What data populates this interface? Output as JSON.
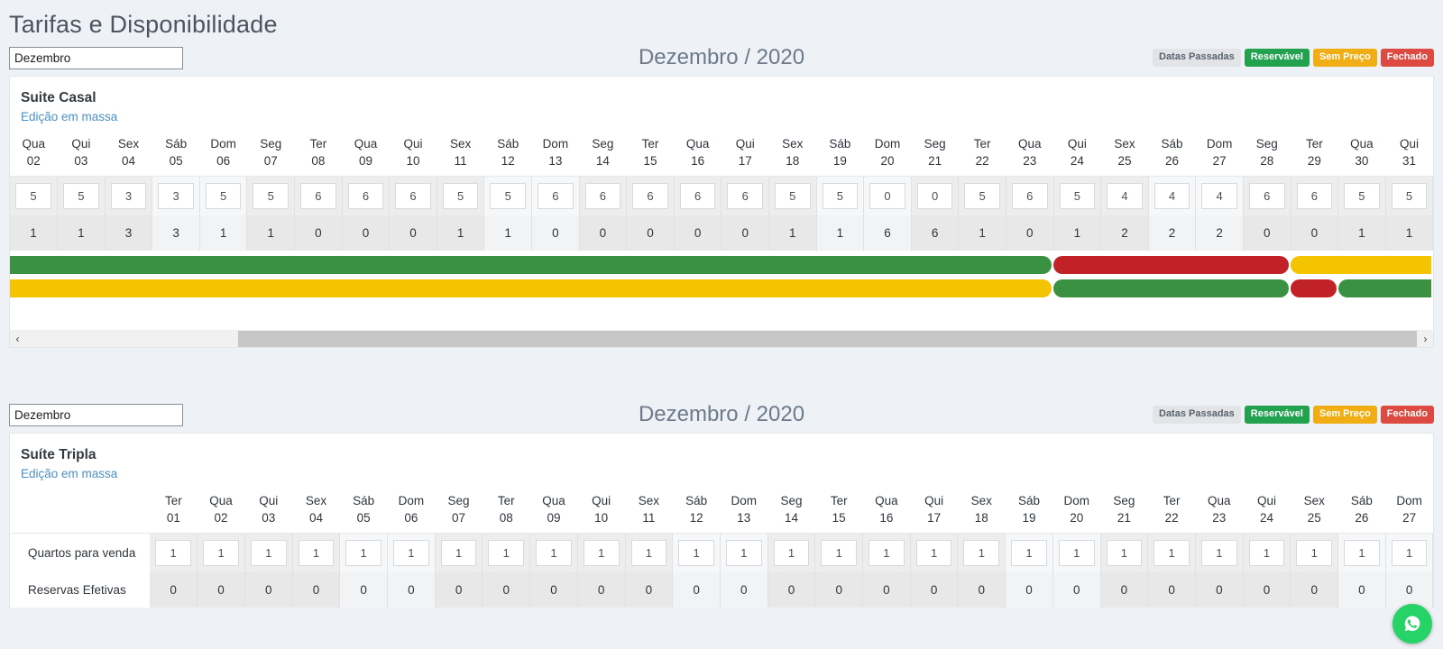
{
  "page": {
    "title": "Tarifas e Disponibilidade"
  },
  "legend": {
    "past": "Datas Passadas",
    "bookable": "Reservável",
    "noprice": "Sem Preço",
    "closed": "Fechado",
    "colors": {
      "past_bg": "#e2e4e8",
      "past_fg": "#5a636d",
      "bookable": "#22a14f",
      "noprice": "#f0ad14",
      "closed": "#dd4a41"
    }
  },
  "sections": [
    {
      "month_value": "Dezembro",
      "month_placeholder": "Dezembro",
      "month_title": "Dezembro / 2020",
      "room_name": "Suite Casal",
      "bulk_edit": "Edição em massa",
      "row1_label": "",
      "row2_label": "",
      "days": [
        {
          "dow": "Qua",
          "num": "02",
          "weekend": false,
          "rate": "5",
          "avail": "1"
        },
        {
          "dow": "Qui",
          "num": "03",
          "weekend": false,
          "rate": "5",
          "avail": "1"
        },
        {
          "dow": "Sex",
          "num": "04",
          "weekend": false,
          "rate": "3",
          "avail": "3"
        },
        {
          "dow": "Sáb",
          "num": "05",
          "weekend": true,
          "rate": "3",
          "avail": "3"
        },
        {
          "dow": "Dom",
          "num": "06",
          "weekend": true,
          "rate": "5",
          "avail": "1"
        },
        {
          "dow": "Seg",
          "num": "07",
          "weekend": false,
          "rate": "5",
          "avail": "1"
        },
        {
          "dow": "Ter",
          "num": "08",
          "weekend": false,
          "rate": "6",
          "avail": "0"
        },
        {
          "dow": "Qua",
          "num": "09",
          "weekend": false,
          "rate": "6",
          "avail": "0"
        },
        {
          "dow": "Qui",
          "num": "10",
          "weekend": false,
          "rate": "6",
          "avail": "0"
        },
        {
          "dow": "Sex",
          "num": "11",
          "weekend": false,
          "rate": "5",
          "avail": "1"
        },
        {
          "dow": "Sáb",
          "num": "12",
          "weekend": true,
          "rate": "5",
          "avail": "1"
        },
        {
          "dow": "Dom",
          "num": "13",
          "weekend": true,
          "rate": "6",
          "avail": "0"
        },
        {
          "dow": "Seg",
          "num": "14",
          "weekend": false,
          "rate": "6",
          "avail": "0"
        },
        {
          "dow": "Ter",
          "num": "15",
          "weekend": false,
          "rate": "6",
          "avail": "0"
        },
        {
          "dow": "Qua",
          "num": "16",
          "weekend": false,
          "rate": "6",
          "avail": "0"
        },
        {
          "dow": "Qui",
          "num": "17",
          "weekend": false,
          "rate": "6",
          "avail": "0"
        },
        {
          "dow": "Sex",
          "num": "18",
          "weekend": false,
          "rate": "5",
          "avail": "1"
        },
        {
          "dow": "Sáb",
          "num": "19",
          "weekend": true,
          "rate": "5",
          "avail": "1"
        },
        {
          "dow": "Dom",
          "num": "20",
          "weekend": true,
          "rate": "0",
          "avail": "6"
        },
        {
          "dow": "Seg",
          "num": "21",
          "weekend": false,
          "rate": "0",
          "avail": "6"
        },
        {
          "dow": "Ter",
          "num": "22",
          "weekend": false,
          "rate": "5",
          "avail": "1"
        },
        {
          "dow": "Qua",
          "num": "23",
          "weekend": false,
          "rate": "6",
          "avail": "0"
        },
        {
          "dow": "Qui",
          "num": "24",
          "weekend": false,
          "rate": "5",
          "avail": "1"
        },
        {
          "dow": "Sex",
          "num": "25",
          "weekend": false,
          "rate": "4",
          "avail": "2"
        },
        {
          "dow": "Sáb",
          "num": "26",
          "weekend": true,
          "rate": "4",
          "avail": "2"
        },
        {
          "dow": "Dom",
          "num": "27",
          "weekend": true,
          "rate": "4",
          "avail": "2"
        },
        {
          "dow": "Seg",
          "num": "28",
          "weekend": false,
          "rate": "6",
          "avail": "0"
        },
        {
          "dow": "Ter",
          "num": "29",
          "weekend": false,
          "rate": "6",
          "avail": "0"
        },
        {
          "dow": "Qua",
          "num": "30",
          "weekend": false,
          "rate": "5",
          "avail": "1"
        },
        {
          "dow": "Qui",
          "num": "31",
          "weekend": false,
          "rate": "5",
          "avail": "1"
        }
      ],
      "status_bars": [
        {
          "name": "bar-row-1",
          "segments": [
            {
              "status": "bookable",
              "color": "#3a9142",
              "start_day": "02",
              "end_day": "23"
            },
            {
              "status": "closed",
              "color": "#c12228",
              "start_day": "24",
              "end_day": "28"
            },
            {
              "status": "noprice",
              "color": "#f5c400",
              "start_day": "29",
              "end_day": "31"
            }
          ]
        },
        {
          "name": "bar-row-2",
          "segments": [
            {
              "status": "noprice",
              "color": "#f5c400",
              "start_day": "02",
              "end_day": "23"
            },
            {
              "status": "bookable",
              "color": "#3a9142",
              "start_day": "24",
              "end_day": "28"
            },
            {
              "status": "closed",
              "color": "#c12228",
              "start_day": "29",
              "end_day": "29"
            },
            {
              "status": "bookable",
              "color": "#3a9142",
              "start_day": "30",
              "end_day": "31"
            }
          ]
        }
      ],
      "scrollbar": {
        "left_arrow": "‹",
        "right_arrow": "›"
      }
    },
    {
      "month_value": "Dezembro",
      "month_placeholder": "Dezembro",
      "month_title": "Dezembro / 2020",
      "room_name": "Suíte Tripla",
      "bulk_edit": "Edição em massa",
      "row1_label": "Quartos para venda",
      "row2_label": "Reservas Efetivas",
      "days": [
        {
          "dow": "Ter",
          "num": "01",
          "weekend": false,
          "rate": "1",
          "avail": "0"
        },
        {
          "dow": "Qua",
          "num": "02",
          "weekend": false,
          "rate": "1",
          "avail": "0"
        },
        {
          "dow": "Qui",
          "num": "03",
          "weekend": false,
          "rate": "1",
          "avail": "0"
        },
        {
          "dow": "Sex",
          "num": "04",
          "weekend": false,
          "rate": "1",
          "avail": "0"
        },
        {
          "dow": "Sáb",
          "num": "05",
          "weekend": true,
          "rate": "1",
          "avail": "0"
        },
        {
          "dow": "Dom",
          "num": "06",
          "weekend": true,
          "rate": "1",
          "avail": "0"
        },
        {
          "dow": "Seg",
          "num": "07",
          "weekend": false,
          "rate": "1",
          "avail": "0"
        },
        {
          "dow": "Ter",
          "num": "08",
          "weekend": false,
          "rate": "1",
          "avail": "0"
        },
        {
          "dow": "Qua",
          "num": "09",
          "weekend": false,
          "rate": "1",
          "avail": "0"
        },
        {
          "dow": "Qui",
          "num": "10",
          "weekend": false,
          "rate": "1",
          "avail": "0"
        },
        {
          "dow": "Sex",
          "num": "11",
          "weekend": false,
          "rate": "1",
          "avail": "0"
        },
        {
          "dow": "Sáb",
          "num": "12",
          "weekend": true,
          "rate": "1",
          "avail": "0"
        },
        {
          "dow": "Dom",
          "num": "13",
          "weekend": true,
          "rate": "1",
          "avail": "0"
        },
        {
          "dow": "Seg",
          "num": "14",
          "weekend": false,
          "rate": "1",
          "avail": "0"
        },
        {
          "dow": "Ter",
          "num": "15",
          "weekend": false,
          "rate": "1",
          "avail": "0"
        },
        {
          "dow": "Qua",
          "num": "16",
          "weekend": false,
          "rate": "1",
          "avail": "0"
        },
        {
          "dow": "Qui",
          "num": "17",
          "weekend": false,
          "rate": "1",
          "avail": "0"
        },
        {
          "dow": "Sex",
          "num": "18",
          "weekend": false,
          "rate": "1",
          "avail": "0"
        },
        {
          "dow": "Sáb",
          "num": "19",
          "weekend": true,
          "rate": "1",
          "avail": "0"
        },
        {
          "dow": "Dom",
          "num": "20",
          "weekend": true,
          "rate": "1",
          "avail": "0"
        },
        {
          "dow": "Seg",
          "num": "21",
          "weekend": false,
          "rate": "1",
          "avail": "0"
        },
        {
          "dow": "Ter",
          "num": "22",
          "weekend": false,
          "rate": "1",
          "avail": "0"
        },
        {
          "dow": "Qua",
          "num": "23",
          "weekend": false,
          "rate": "1",
          "avail": "0"
        },
        {
          "dow": "Qui",
          "num": "24",
          "weekend": false,
          "rate": "1",
          "avail": "0"
        },
        {
          "dow": "Sex",
          "num": "25",
          "weekend": false,
          "rate": "1",
          "avail": "0"
        },
        {
          "dow": "Sáb",
          "num": "26",
          "weekend": true,
          "rate": "1",
          "avail": "0"
        },
        {
          "dow": "Dom",
          "num": "27",
          "weekend": true,
          "rate": "1",
          "avail": "0"
        }
      ],
      "status_bars": [],
      "scrollbar": null
    }
  ],
  "floating_action": {
    "icon": "whatsapp-icon",
    "color": "#25d366"
  }
}
